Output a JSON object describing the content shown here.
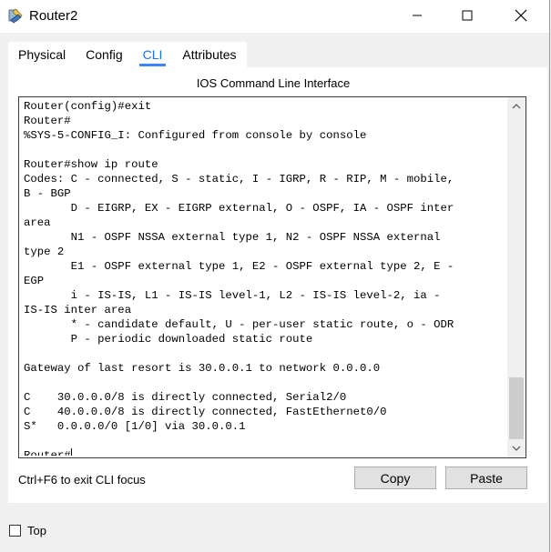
{
  "window": {
    "title": "Router2",
    "app_icon": "packet-tracer-icon"
  },
  "tabs": [
    {
      "label": "Physical",
      "active": false
    },
    {
      "label": "Config",
      "active": false
    },
    {
      "label": "CLI",
      "active": true
    },
    {
      "label": "Attributes",
      "active": false
    }
  ],
  "cli": {
    "heading": "IOS Command Line Interface",
    "lines": [
      "Router(config)#exit",
      "Router#",
      "%SYS-5-CONFIG_I: Configured from console by console",
      "",
      "Router#show ip route",
      "Codes: C - connected, S - static, I - IGRP, R - RIP, M - mobile,",
      "B - BGP",
      "       D - EIGRP, EX - EIGRP external, O - OSPF, IA - OSPF inter",
      "area",
      "       N1 - OSPF NSSA external type 1, N2 - OSPF NSSA external",
      "type 2",
      "       E1 - OSPF external type 1, E2 - OSPF external type 2, E -",
      "EGP",
      "       i - IS-IS, L1 - IS-IS level-1, L2 - IS-IS level-2, ia -",
      "IS-IS inter area",
      "       * - candidate default, U - per-user static route, o - ODR",
      "       P - periodic downloaded static route",
      "",
      "Gateway of last resort is 30.0.0.1 to network 0.0.0.0",
      "",
      "C    30.0.0.0/8 is directly connected, Serial2/0",
      "C    40.0.0.0/8 is directly connected, FastEthernet0/0",
      "S*   0.0.0.0/0 [1/0] via 30.0.0.1",
      ""
    ],
    "prompt": "Router#"
  },
  "footer": {
    "hint": "Ctrl+F6 to exit CLI focus",
    "copy_label": "Copy",
    "paste_label": "Paste"
  },
  "top_checkbox": {
    "label": "Top",
    "checked": false
  },
  "colors": {
    "active_tab": "#1a73e8",
    "tab_underline": "#3a86ff"
  }
}
